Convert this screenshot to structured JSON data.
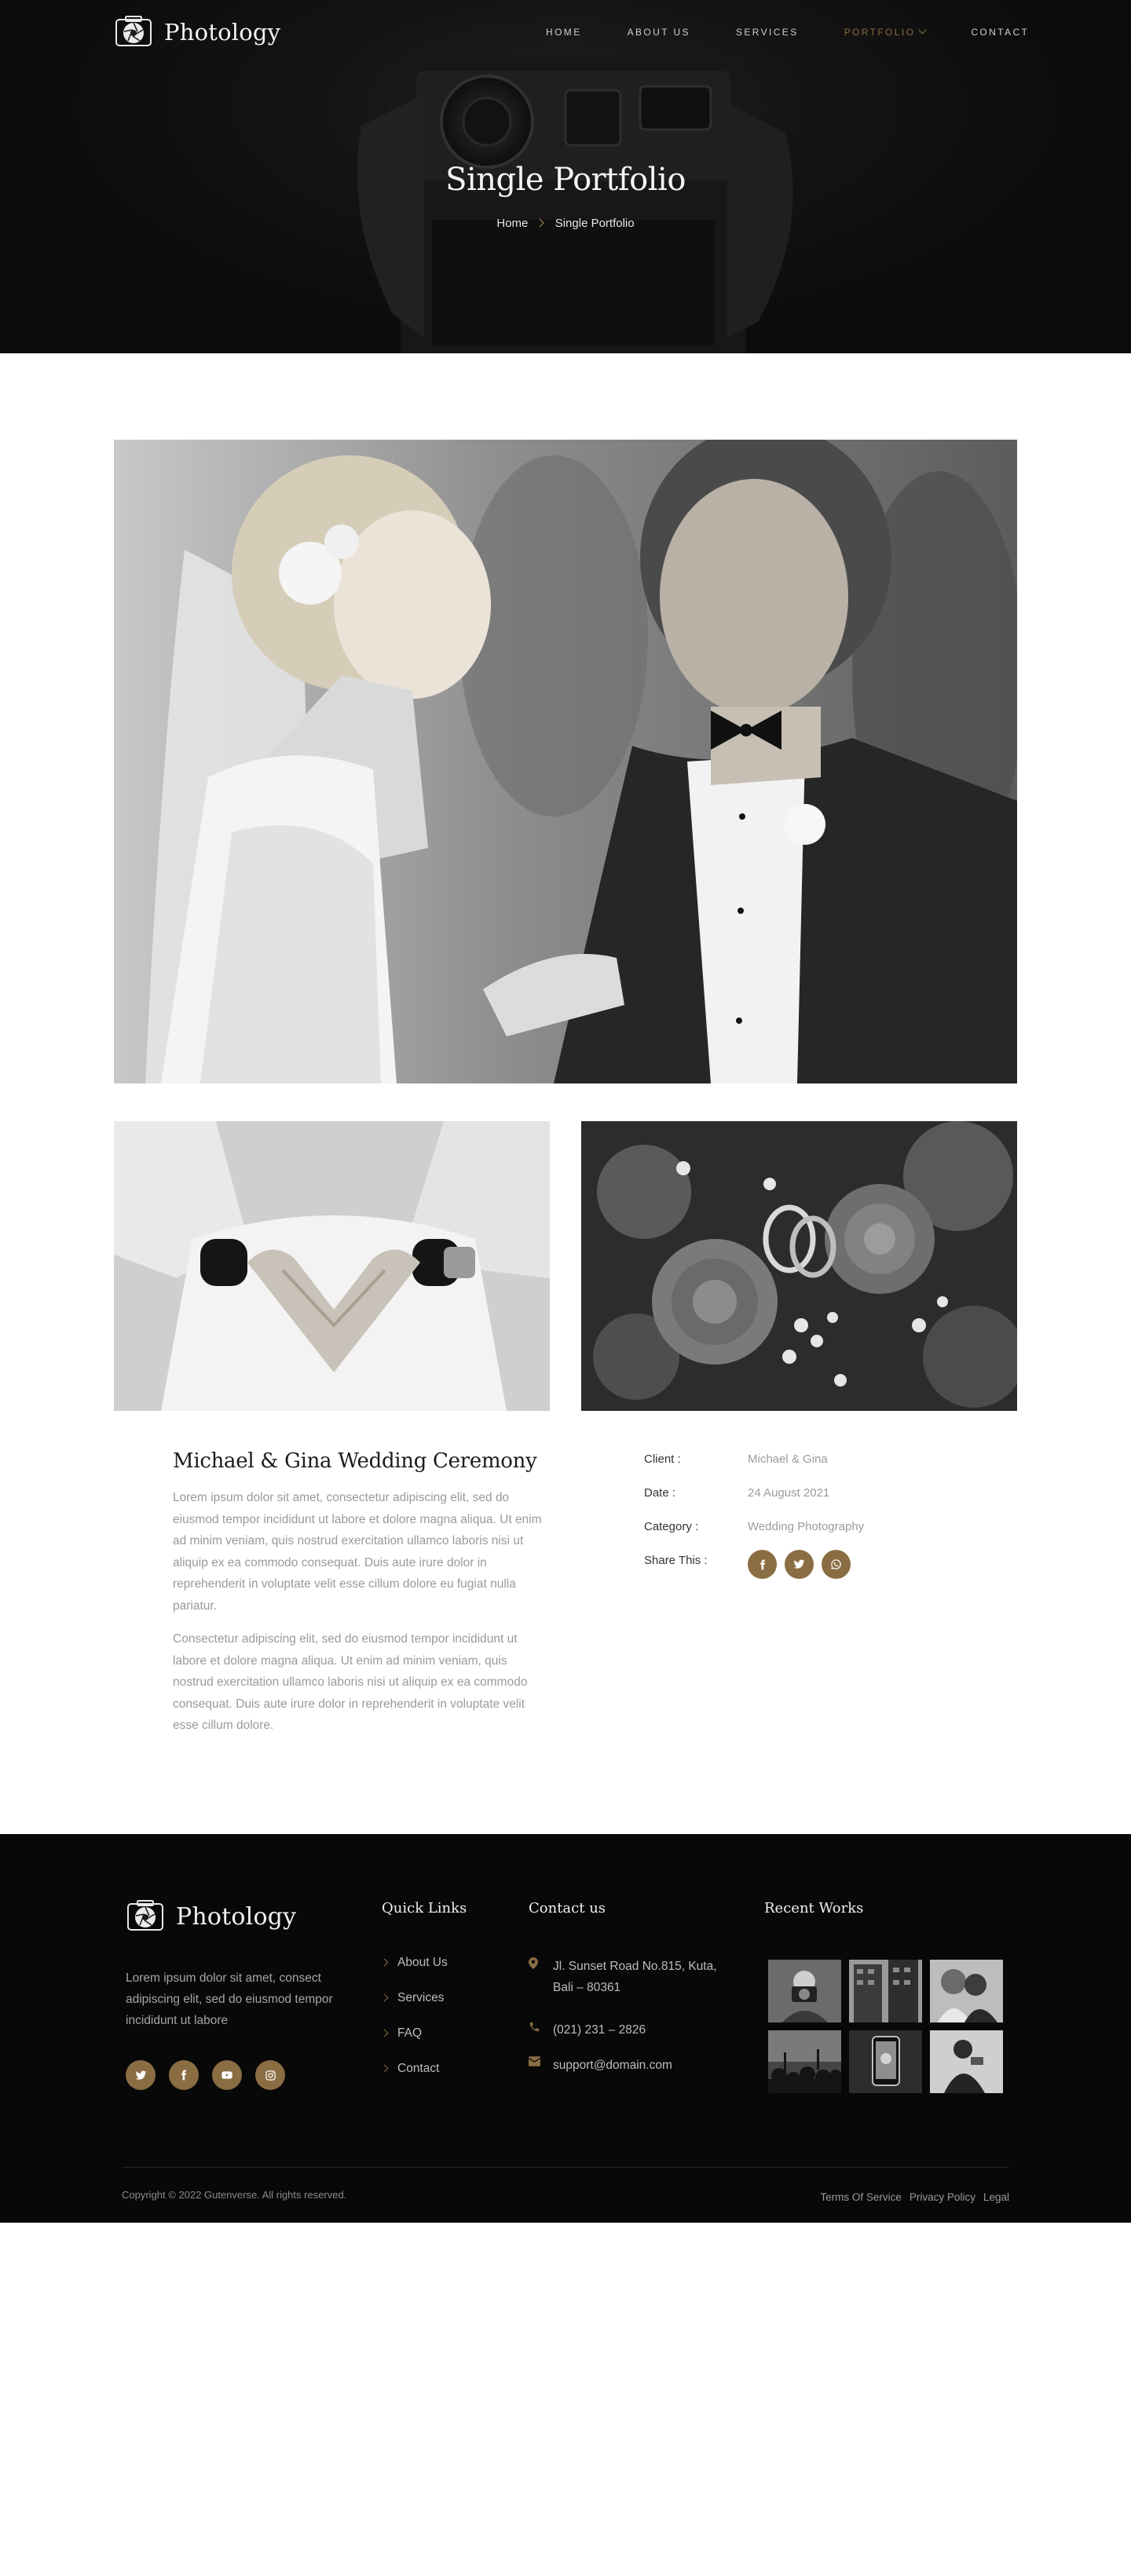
{
  "brand": {
    "name": "Photology"
  },
  "nav": {
    "items": [
      {
        "label": "HOME",
        "active": false
      },
      {
        "label": "ABOUT US",
        "active": false
      },
      {
        "label": "SERVICES",
        "active": false
      },
      {
        "label": "PORTFOLIO",
        "active": true,
        "dropdown": true
      },
      {
        "label": "CONTACT",
        "active": false
      }
    ]
  },
  "hero": {
    "title": "Single Portfolio",
    "breadcrumb": {
      "home": "Home",
      "current": "Single Portfolio"
    }
  },
  "project": {
    "title": "Michael & Gina Wedding Ceremony",
    "paragraphs": [
      "Lorem ipsum dolor sit amet, consectetur adipiscing elit, sed do eiusmod tempor incididunt ut labore et dolore magna aliqua. Ut enim ad minim veniam, quis nostrud exercitation ullamco laboris nisi ut aliquip ex ea commodo consequat. Duis aute irure dolor in reprehenderit in voluptate velit esse cillum dolore eu fugiat nulla pariatur.",
      "Consectetur adipiscing elit, sed do eiusmod tempor incididunt ut labore et dolore magna aliqua. Ut enim ad minim veniam, quis nostrud exercitation ullamco laboris nisi ut aliquip ex ea commodo consequat. Duis aute irure dolor in reprehenderit in voluptate velit esse cillum dolore."
    ],
    "meta": {
      "client_label": "Client :",
      "client": "Michael & Gina",
      "date_label": "Date :",
      "date": "24 August 2021",
      "category_label": "Category :",
      "category": "Wedding Photography",
      "share_label": "Share This :"
    },
    "share_icons": [
      "facebook-icon",
      "twitter-icon",
      "whatsapp-icon"
    ]
  },
  "footer": {
    "about": "Lorem ipsum dolor sit amet, consect adipiscing elit, sed do eiusmod tempor incididunt ut labore",
    "social_icons": [
      "twitter-icon",
      "facebook-icon",
      "youtube-icon",
      "instagram-icon"
    ],
    "quick_links_title": "Quick Links",
    "quick_links": [
      "About Us",
      "Services",
      "FAQ",
      "Contact"
    ],
    "contact_title": "Contact us",
    "address": "Jl. Sunset Road No.815, Kuta, Bali – 80361",
    "phone": "(021) 231 – 2826",
    "email": "support@domain.com",
    "recent_title": "Recent Works",
    "copyright": "Copyright © 2022 Gutenverse. All rights reserved.",
    "legal": [
      "Terms Of Service",
      "Privacy Policy",
      "Legal"
    ]
  },
  "colors": {
    "accent": "#8a6d43",
    "footer_bg": "#080808",
    "hero_text": "#f4f4f4"
  }
}
